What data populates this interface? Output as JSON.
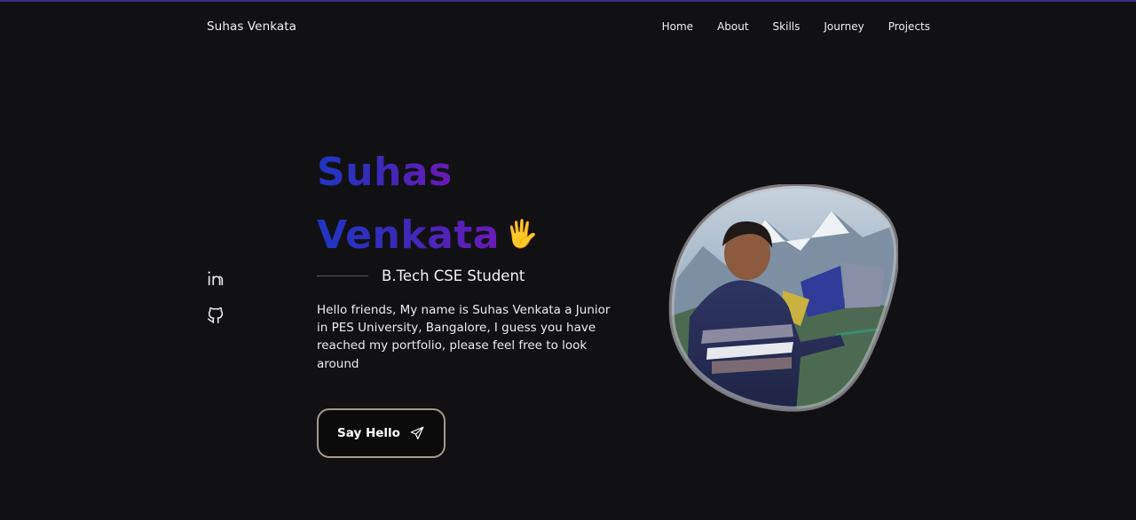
{
  "header": {
    "brand": "Suhas Venkata",
    "nav": [
      "Home",
      "About",
      "Skills",
      "Journey",
      "Projects"
    ]
  },
  "social": {
    "icons": [
      "linkedin-icon",
      "github-icon"
    ]
  },
  "hero": {
    "first_name": "Suhas",
    "last_name": "Venkata",
    "wave_emoji": "🖐",
    "subtitle": "B.Tech CSE Student",
    "description": "Hello friends, My name is Suhas Venkata a Junior in PES University, Bangalore, I guess you have reached my portfolio, please feel free to look around",
    "cta_label": "Say Hello",
    "cta_icon": "send-icon",
    "photo_icon": "profile-photo"
  },
  "colors": {
    "background": "#111114",
    "accent_start": "#2036c4",
    "accent_end": "#6b1ab6",
    "button_border": "#a39b8a"
  }
}
